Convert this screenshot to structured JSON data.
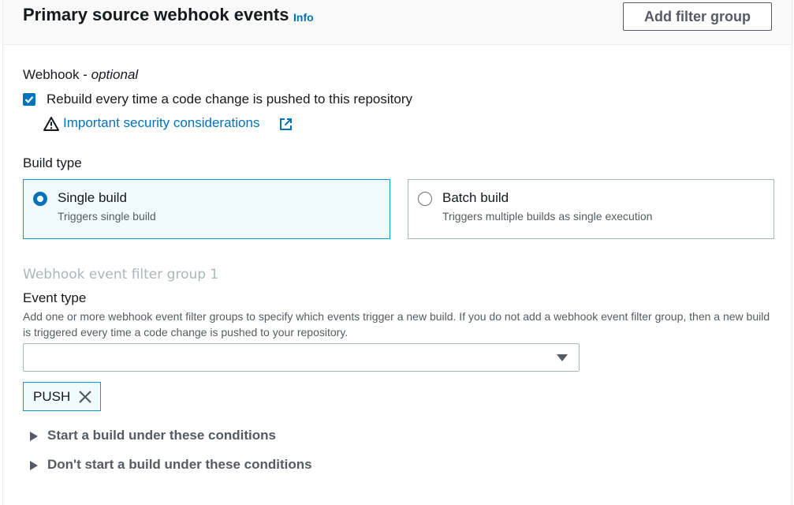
{
  "header": {
    "title": "Primary source webhook events",
    "info": "Info",
    "add_filter_group": "Add filter group"
  },
  "webhook": {
    "label": "Webhook",
    "optional": "optional",
    "checkbox_label": "Rebuild every time a code change is pushed to this repository",
    "checked": true,
    "security_link": "Important security considerations"
  },
  "build_type": {
    "label": "Build type",
    "options": [
      {
        "title": "Single build",
        "description": "Triggers single build",
        "selected": true
      },
      {
        "title": "Batch build",
        "description": "Triggers multiple builds as single execution",
        "selected": false
      }
    ]
  },
  "filter_group": {
    "heading": "Webhook event filter group 1",
    "event_type_label": "Event type",
    "event_type_description": "Add one or more webhook event filter groups to specify which events trigger a new build. If you do not add a webhook event filter group, then a new build is triggered every time a code change is pushed to your repository.",
    "select_value": "",
    "tokens": [
      "PUSH"
    ],
    "expanders": [
      "Start a build under these conditions",
      "Don't start a build under these conditions"
    ]
  },
  "colors": {
    "link": "#0073bb",
    "selected_border": "#00a1c9",
    "selected_bg": "#f1faff",
    "text": "#16191f",
    "secondary_text": "#545b64"
  }
}
